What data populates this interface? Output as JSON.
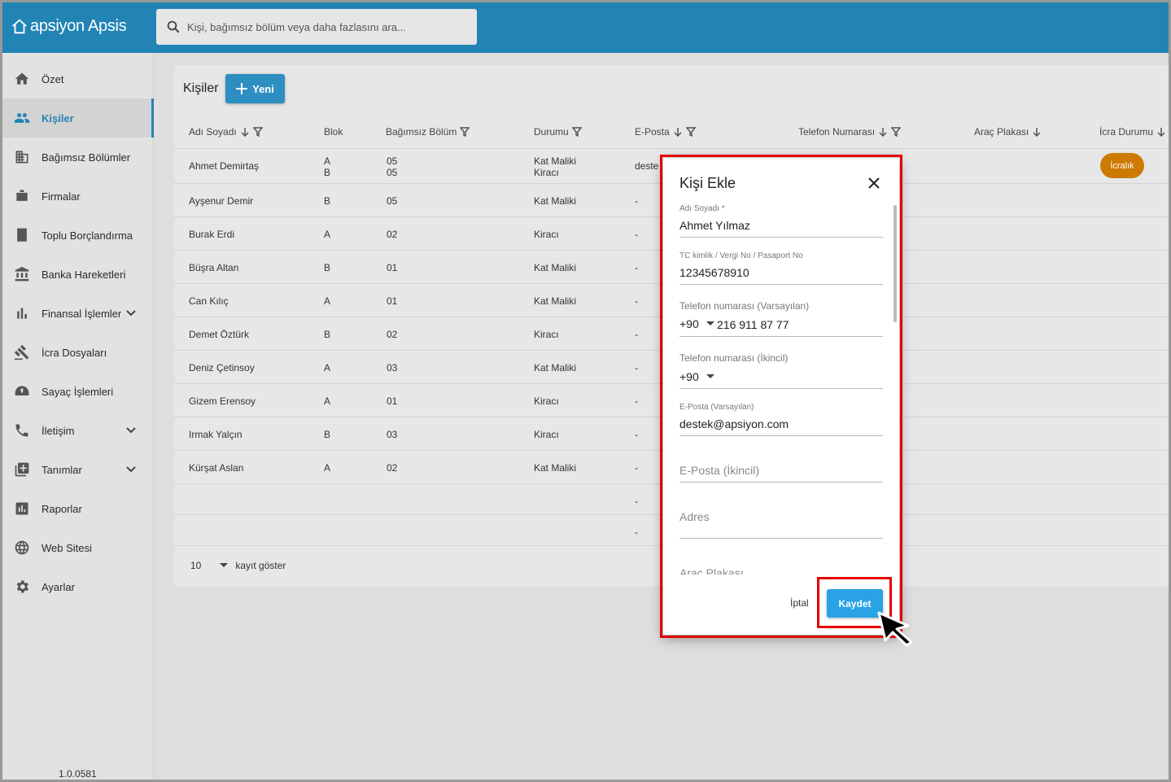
{
  "app": {
    "name": "apsiyon Apsis"
  },
  "search": {
    "placeholder": "Kişi, bağımsız bölüm veya daha fazlasını ara..."
  },
  "sidebar": {
    "items": [
      {
        "label": "Özet",
        "icon": "home-icon"
      },
      {
        "label": "Kişiler",
        "icon": "people-icon",
        "active": true
      },
      {
        "label": "Bağımsız Bölümler",
        "icon": "building-icon"
      },
      {
        "label": "Firmalar",
        "icon": "briefcase-icon"
      },
      {
        "label": "Toplu Borçlandırma",
        "icon": "receipt-icon"
      },
      {
        "label": "Banka Hareketleri",
        "icon": "bank-icon"
      },
      {
        "label": "Finansal İşlemler",
        "icon": "bar-chart-icon",
        "expandable": true
      },
      {
        "label": "İcra Dosyaları",
        "icon": "gavel-icon"
      },
      {
        "label": "Sayaç İşlemleri",
        "icon": "meter-icon"
      },
      {
        "label": "İletişim",
        "icon": "phone-icon",
        "expandable": true
      },
      {
        "label": "Tanımlar",
        "icon": "add-box-icon",
        "expandable": true
      },
      {
        "label": "Raporlar",
        "icon": "report-icon"
      },
      {
        "label": "Web Sitesi",
        "icon": "globe-icon"
      },
      {
        "label": "Ayarlar",
        "icon": "gear-icon"
      }
    ],
    "version": "1.0.0581"
  },
  "page": {
    "title": "Kişiler",
    "new_label": "Yeni"
  },
  "table": {
    "columns": [
      "Adı Soyadı",
      "Blok",
      "Bağımsız Bölüm",
      "Durumu",
      "E-Posta",
      "Telefon Numarası",
      "Araç Plakası",
      "İcra Durumu"
    ],
    "rows": [
      {
        "name": "Ahmet Demirtaş",
        "blok": "A\nB",
        "bolum": "05\n05",
        "durum": "Kat Maliki\nKiracı",
        "eposta": "deste"
      },
      {
        "name": "Ayşenur Demir",
        "blok": "B",
        "bolum": "05",
        "durum": "Kat Maliki",
        "eposta": "-"
      },
      {
        "name": "Burak Erdi",
        "blok": "A",
        "bolum": "02",
        "durum": "Kiracı",
        "eposta": "-"
      },
      {
        "name": "Büşra Altan",
        "blok": "B",
        "bolum": "01",
        "durum": "Kat Maliki",
        "eposta": "-"
      },
      {
        "name": "Can Kılıç",
        "blok": "A",
        "bolum": "01",
        "durum": "Kat Maliki",
        "eposta": "-"
      },
      {
        "name": "Demet Öztürk",
        "blok": "B",
        "bolum": "02",
        "durum": "Kiracı",
        "eposta": "-"
      },
      {
        "name": "Deniz Çetinsoy",
        "blok": "A",
        "bolum": "03",
        "durum": "Kat Maliki",
        "eposta": "-"
      },
      {
        "name": "Gizem Erensoy",
        "blok": "A",
        "bolum": "01",
        "durum": "Kiracı",
        "eposta": "-"
      },
      {
        "name": "Irmak Yalçın",
        "blok": "B",
        "bolum": "03",
        "durum": "Kiracı",
        "eposta": "-"
      },
      {
        "name": "Kürşat Aslan",
        "blok": "A",
        "bolum": "02",
        "durum": "Kat Maliki",
        "eposta": "-"
      },
      {
        "name": "",
        "blok": "",
        "bolum": "",
        "durum": "",
        "eposta": "-"
      },
      {
        "name": "",
        "blok": "",
        "bolum": "",
        "durum": "",
        "eposta": "-"
      }
    ],
    "icra_badge": "İcralık",
    "page_size": "10",
    "page_size_label": "kayıt göster"
  },
  "dialog": {
    "title": "Kişi Ekle",
    "fields": {
      "name_label": "Adı Soyadı *",
      "name_value": "Ahmet Yılmaz",
      "tc_label": "TC kimlik / Vergi No / Pasaport No",
      "tc_value": "12345678910",
      "phone1_label": "Telefon numarası (Varsayılan)",
      "phone1_code": "+90",
      "phone1_value": "216 911 87 77",
      "phone2_label": "Telefon numarası (İkincil)",
      "phone2_code": "+90",
      "email1_label": "E-Posta (Varsayılan)",
      "email1_value": "destek@apsiyon.com",
      "email2_placeholder": "E-Posta (İkincil)",
      "address_placeholder": "Adres",
      "plate_placeholder": "Araç Plakası"
    },
    "cancel_label": "İptal",
    "save_label": "Kaydet"
  },
  "colors": {
    "topbar": "#2284b5",
    "accent": "#29a3e6",
    "highlight": "#e30000",
    "badge": "#cc7a00"
  }
}
